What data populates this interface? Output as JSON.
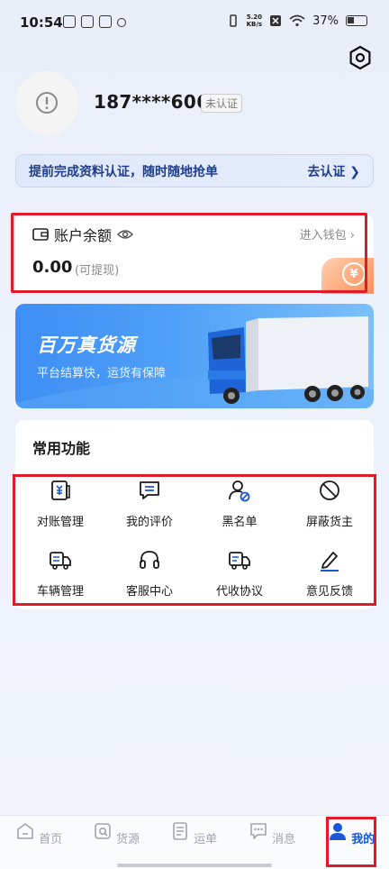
{
  "status_bar": {
    "time": "10:54",
    "speed": "5.20\nKB/s",
    "battery": "37%"
  },
  "profile": {
    "phone": "187****6067",
    "badge": "未认证"
  },
  "verify_banner": {
    "text": "提前完成资料认证，随时随地抢单",
    "link": "去认证"
  },
  "balance": {
    "title": "账户余额",
    "enter_wallet": "进入钱包",
    "amount": "0.00",
    "sub": "(可提现)",
    "coin_symbol": "¥"
  },
  "promo": {
    "title": "百万真货源",
    "subtitle": "平台结算快，运货有保障"
  },
  "functions": {
    "title": "常用功能",
    "items": [
      {
        "label": "对账管理",
        "icon": "ledger-icon"
      },
      {
        "label": "我的评价",
        "icon": "comment-icon"
      },
      {
        "label": "黑名单",
        "icon": "blacklist-icon"
      },
      {
        "label": "屏蔽货主",
        "icon": "block-icon"
      },
      {
        "label": "车辆管理",
        "icon": "truck-icon"
      },
      {
        "label": "客服中心",
        "icon": "headset-icon"
      },
      {
        "label": "代收协议",
        "icon": "agreement-icon"
      },
      {
        "label": "意见反馈",
        "icon": "pen-icon"
      }
    ]
  },
  "bottom_nav": {
    "items": [
      {
        "label": "首页",
        "icon": "home-icon"
      },
      {
        "label": "货源",
        "icon": "cargo-icon"
      },
      {
        "label": "运单",
        "icon": "waybill-icon"
      },
      {
        "label": "消息",
        "icon": "message-icon"
      },
      {
        "label": "我的",
        "icon": "user-icon"
      }
    ],
    "active": "我的"
  },
  "colors": {
    "accent": "#1a56d6",
    "highlight_outline": "#e11a2b",
    "banner_text": "#1e3e8c"
  }
}
